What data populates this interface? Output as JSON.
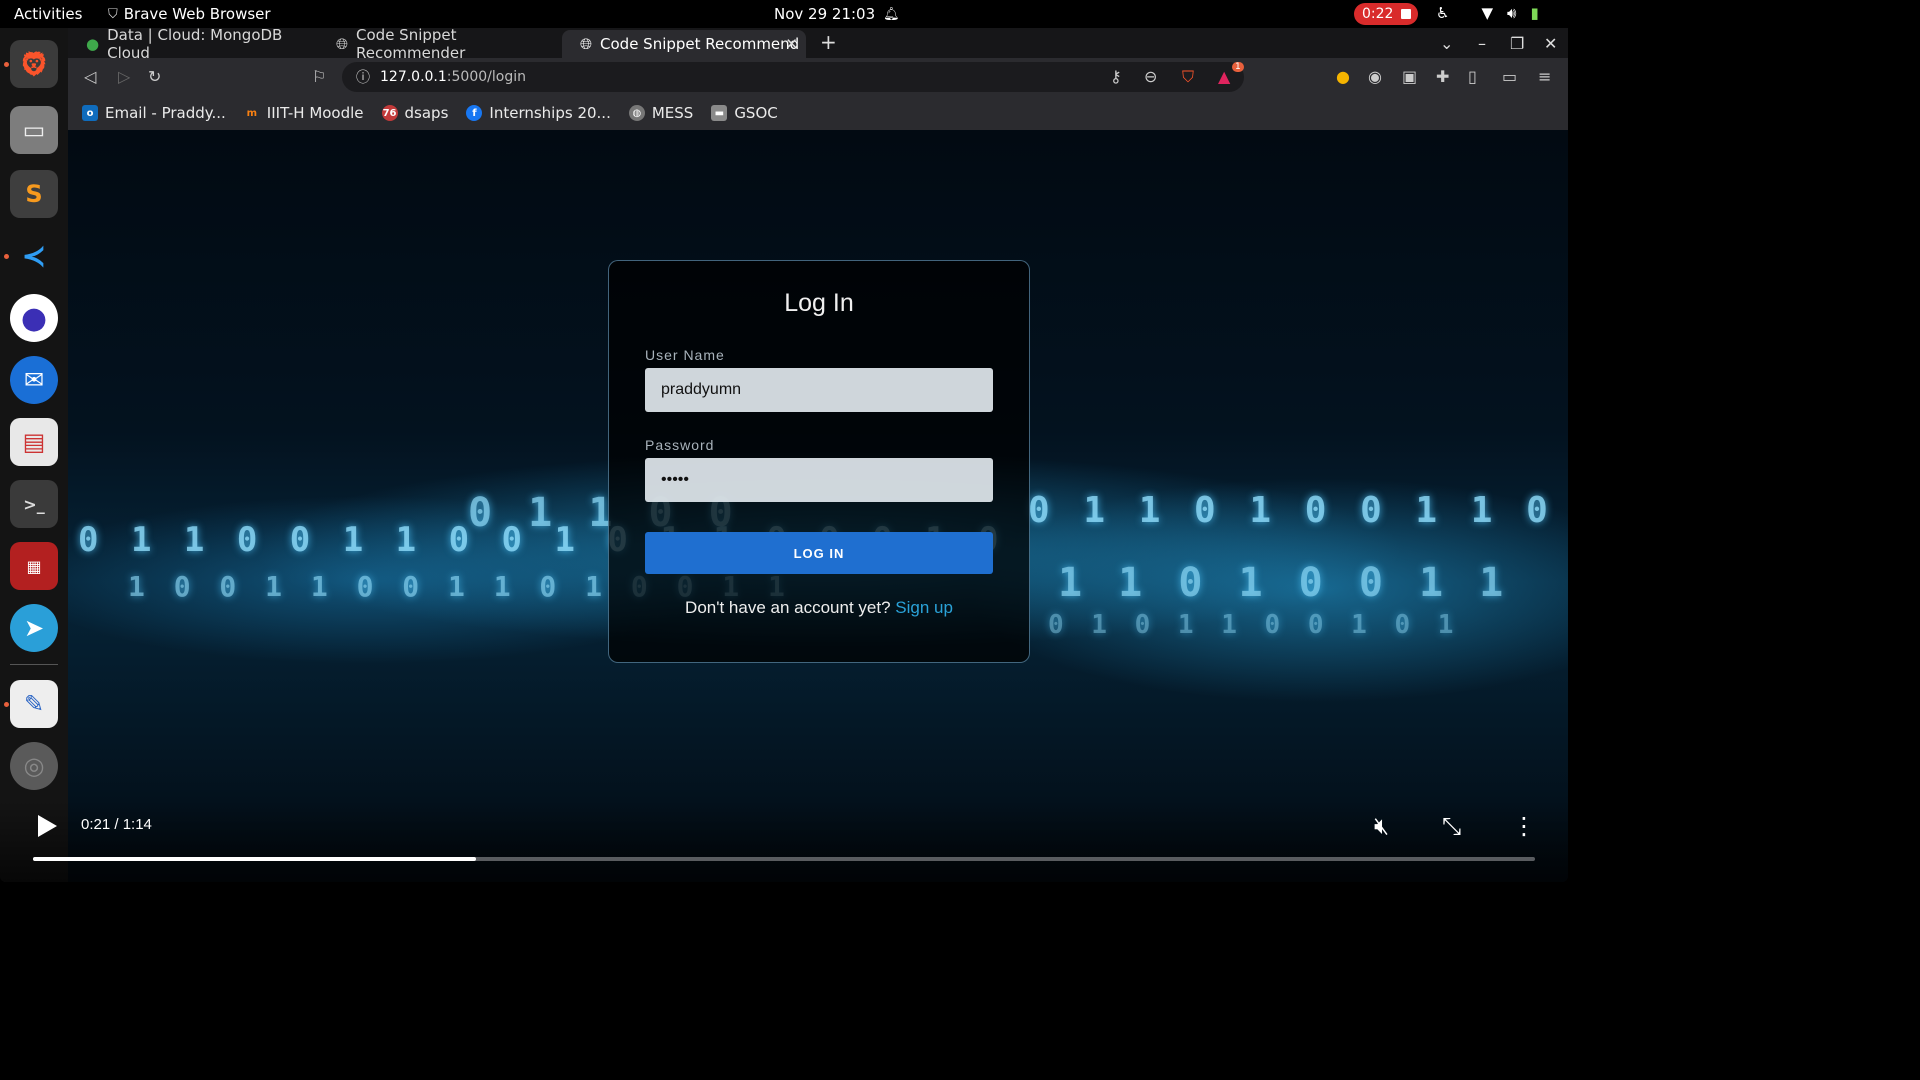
{
  "topbar": {
    "activities": "Activities",
    "app_name": "Brave Web Browser",
    "datetime": "Nov 29  21:03",
    "recording_time": "0:22"
  },
  "browser": {
    "tabs": [
      {
        "label": "Data | Cloud: MongoDB Cloud",
        "active": false
      },
      {
        "label": "Code Snippet Recommender",
        "active": false
      },
      {
        "label": "Code Snippet Recommend",
        "active": true
      }
    ],
    "url_host": "127.0.0.1",
    "url_path": ":5000/login",
    "brave_badge_count": "1",
    "bookmarks": [
      {
        "label": "Email - Praddy...",
        "icon": "outlook-icon",
        "color": "#0f6cbd"
      },
      {
        "label": "IIIT-H Moodle",
        "icon": "moodle-icon",
        "color": "#f98012"
      },
      {
        "label": "dsaps",
        "icon": "dsaps-icon",
        "color": "#c23a3a",
        "badge": "76"
      },
      {
        "label": "Internships 20...",
        "icon": "facebook-icon",
        "color": "#1877f2"
      },
      {
        "label": "MESS",
        "icon": "globe-icon",
        "color": "#777777"
      },
      {
        "label": "GSOC",
        "icon": "folder-icon",
        "color": "#8a8a8a"
      }
    ]
  },
  "login": {
    "title": "Log In",
    "username_label": "User Name",
    "username_value": "praddyumn",
    "password_label": "Password",
    "password_value": "•••••",
    "button_label": "LOG IN",
    "signup_prompt": "Don't have an account yet?",
    "signup_link": "Sign up"
  },
  "video": {
    "time": "0:21 / 1:14",
    "progress_fraction": 0.295
  },
  "colors": {
    "accent_button": "#1f6fd0",
    "link": "#2aa2d8",
    "record": "#d92b2b"
  }
}
